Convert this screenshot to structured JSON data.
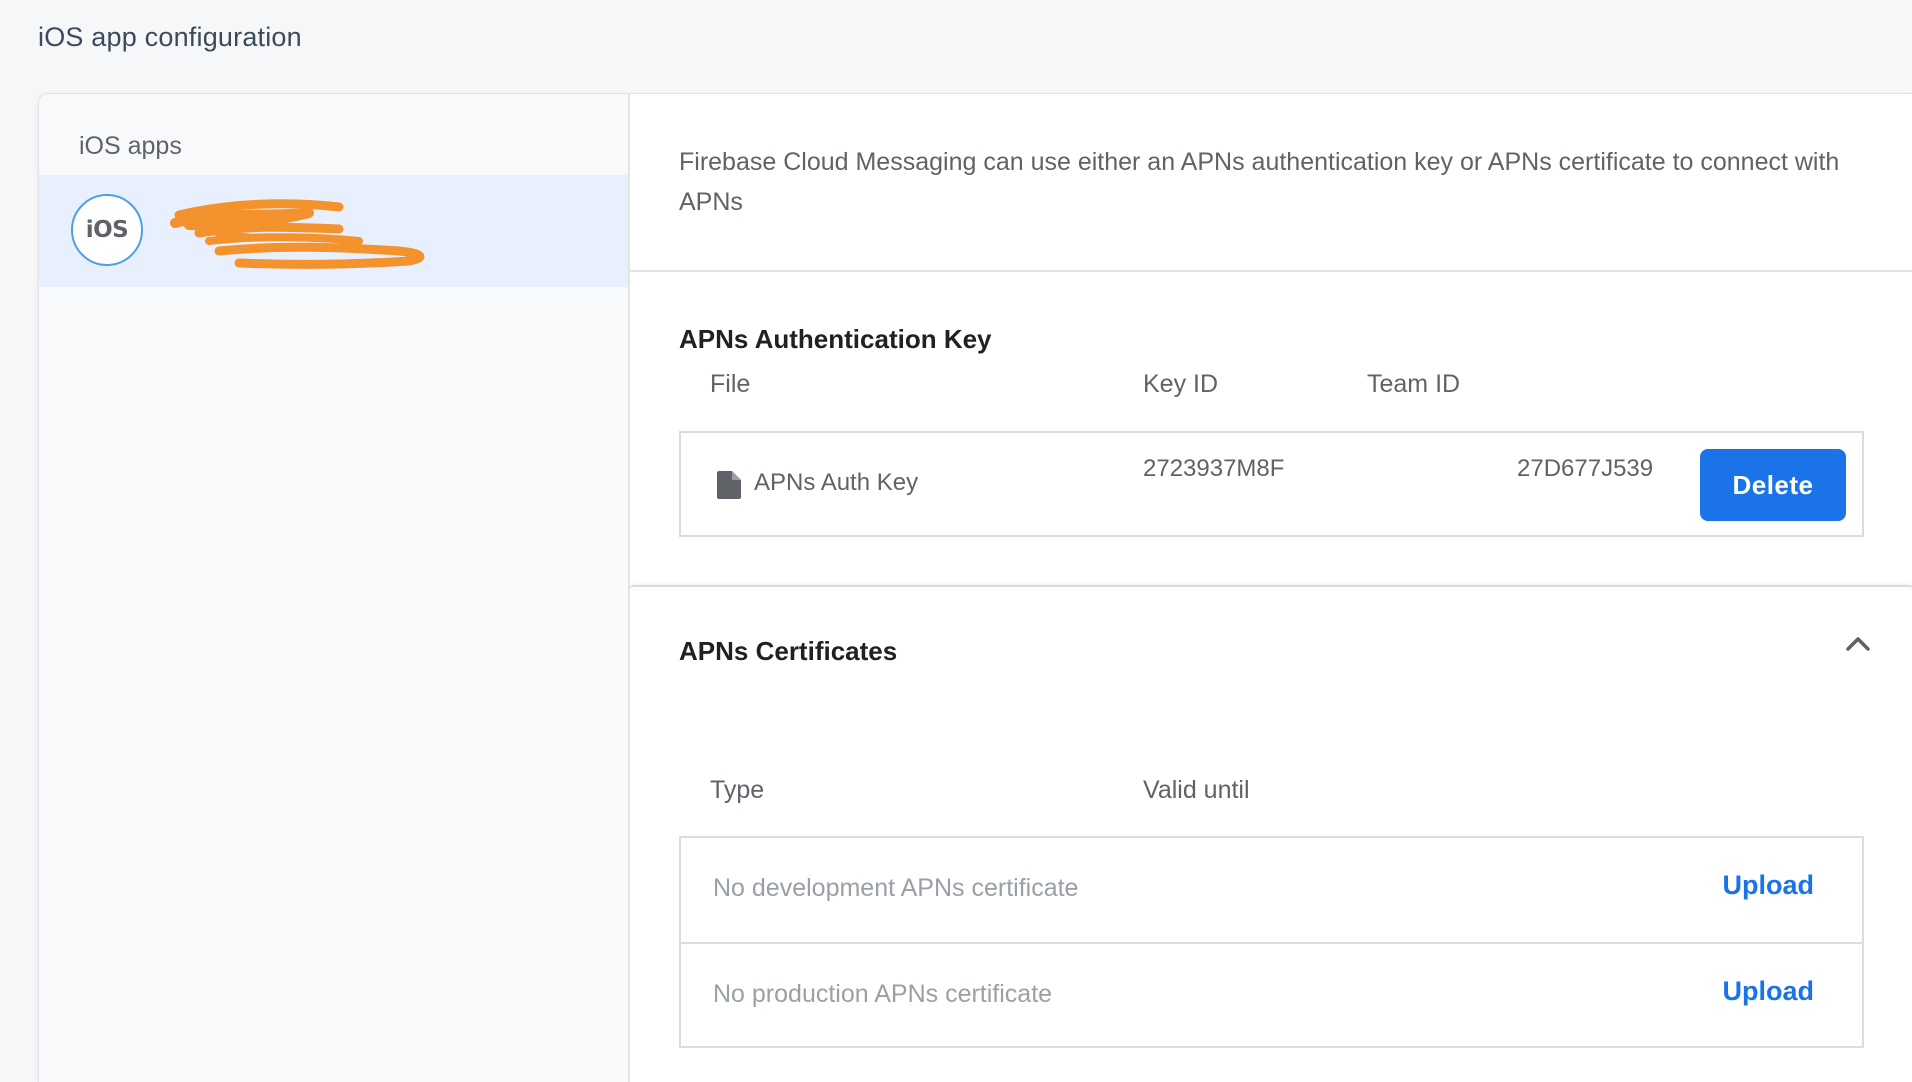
{
  "page": {
    "title": "iOS app configuration"
  },
  "sidebar": {
    "title": "iOS apps",
    "app": {
      "icon_label": "iOS",
      "name": "",
      "bundle_id": "",
      "redacted": true,
      "redaction_color": "#f4922e"
    }
  },
  "main": {
    "intro": "Firebase Cloud Messaging can use either an APNs authentication key or APNs certificate to connect with APNs",
    "auth_key": {
      "title": "APNs Authentication Key",
      "columns": [
        "File",
        "Key ID",
        "Team ID"
      ],
      "row": {
        "file_icon": "file-icon",
        "file": "APNs Auth Key",
        "key_id": "2723937M8F",
        "team_id": "27D677J539",
        "delete_label": "Delete"
      }
    },
    "certificates": {
      "title": "APNs Certificates",
      "collapse_icon": "chevron-up-icon",
      "columns": [
        "Type",
        "Valid until"
      ],
      "rows": [
        {
          "label": "No development APNs certificate",
          "action": "Upload"
        },
        {
          "label": "No production APNs certificate",
          "action": "Upload"
        }
      ]
    }
  },
  "colors": {
    "accent": "#1a73e8",
    "selected_bg": "#e8f0fd",
    "page_bg": "#f6f7f9"
  }
}
